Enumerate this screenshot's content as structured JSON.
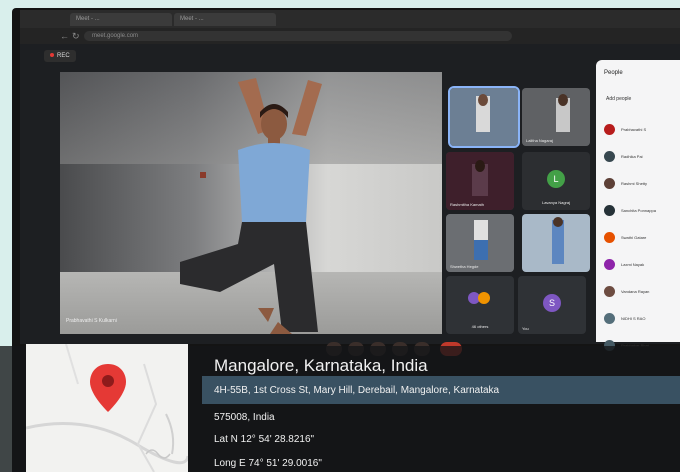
{
  "browser": {
    "tabs": [
      "Meet - ...",
      "Meet - ..."
    ],
    "url": "meet.google.com"
  },
  "meet": {
    "rec_label": "REC",
    "main_speaker": "Prabhavathi S Kulkarni",
    "tiles": [
      {
        "label": ""
      },
      {
        "label": "Lalitha Nagaraj"
      },
      {
        "label": "Rashmitha Kamath"
      },
      {
        "label": "Lavanya Nagraj",
        "avatar": "L",
        "avatar_color": "#43a047"
      },
      {
        "label": "Shwetha Hegde"
      },
      {
        "label": ""
      },
      {
        "label": "46 others"
      },
      {
        "label": "You",
        "avatar": "S",
        "avatar_color": "#7e57c2"
      }
    ],
    "people_panel": {
      "title": "People",
      "subtitle": "Add people",
      "people": [
        {
          "name": "Prabhavathi S",
          "color": "#b71c1c"
        },
        {
          "name": "Radhika Pai",
          "color": "#37474f"
        },
        {
          "name": "Rashmi Shetty",
          "color": "#5d4037"
        },
        {
          "name": "Sanchita Ponnappa",
          "color": "#263238"
        },
        {
          "name": "Swathi Gatare",
          "color": "#e65100"
        },
        {
          "name": "Laxmi Nayak",
          "color": "#8e24aa"
        },
        {
          "name": "Vandana Rayan",
          "color": "#6d4c41"
        },
        {
          "name": "NIDHI S RAO",
          "color": "#546e7a"
        },
        {
          "name": "Prabhakar Bhat",
          "color": "#455a64"
        }
      ]
    }
  },
  "location": {
    "city": "Mangalore, Karnataka, India",
    "address_line1": "4H-55B, 1st Cross St, Mary Hill, Derebail, Mangalore, Karnataka",
    "address_line2": "575008, India",
    "lat": "Lat N 12° 54' 28.8216\"",
    "long": "Long E 74° 51' 29.0016\"",
    "pin_color": "#e53935"
  }
}
